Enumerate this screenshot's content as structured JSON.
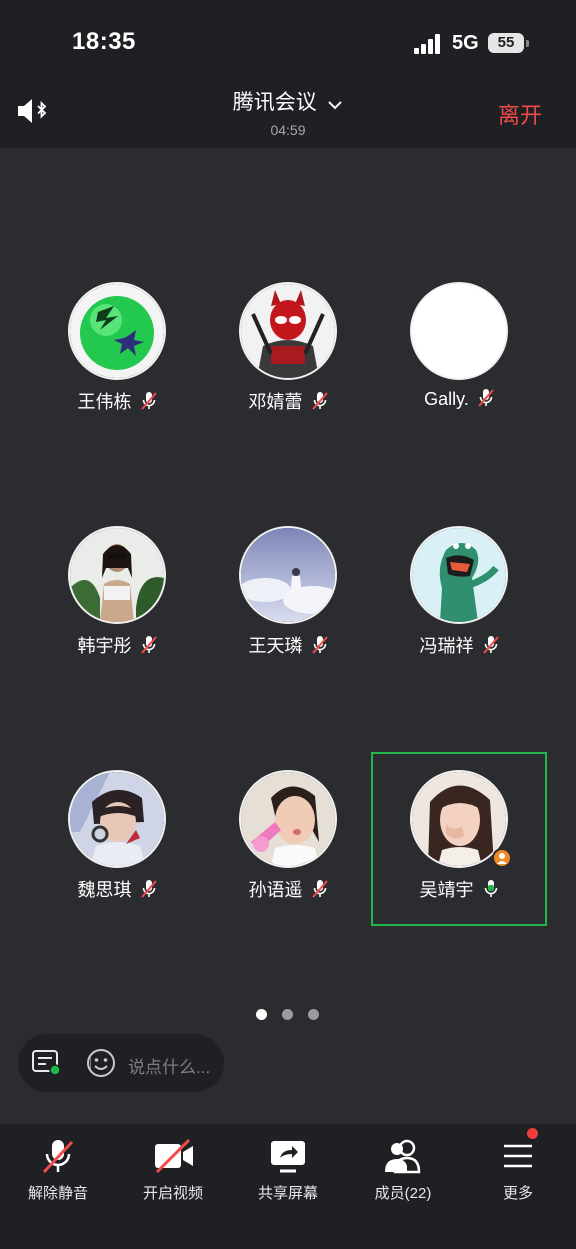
{
  "status_bar": {
    "time": "18:35",
    "network": "5G",
    "battery": "55"
  },
  "header": {
    "title": "腾讯会议",
    "duration": "04:59",
    "leave_label": "离开"
  },
  "participants": [
    {
      "name": "王伟栋",
      "mic": "muted"
    },
    {
      "name": "邓婧蕾",
      "mic": "muted"
    },
    {
      "name": "Gally.",
      "mic": "muted"
    },
    {
      "name": "韩宇彤",
      "mic": "muted"
    },
    {
      "name": "王天璘",
      "mic": "muted"
    },
    {
      "name": "冯瑞祥",
      "mic": "muted"
    },
    {
      "name": "魏思琪",
      "mic": "muted"
    },
    {
      "name": "孙语遥",
      "mic": "muted"
    },
    {
      "name": "吴靖宇",
      "mic": "active",
      "is_host": true,
      "is_speaking": true
    }
  ],
  "pager": {
    "pages": 3,
    "current": 1
  },
  "chat": {
    "placeholder": "说点什么..."
  },
  "toolbar": {
    "unmute_label": "解除静音",
    "video_label": "开启视频",
    "share_label": "共享屏幕",
    "members_label": "成员(22)",
    "more_label": "更多"
  },
  "colors": {
    "accent_red": "#f04a4a",
    "speaking_green": "#22b54c",
    "host_orange": "#f08a24"
  }
}
